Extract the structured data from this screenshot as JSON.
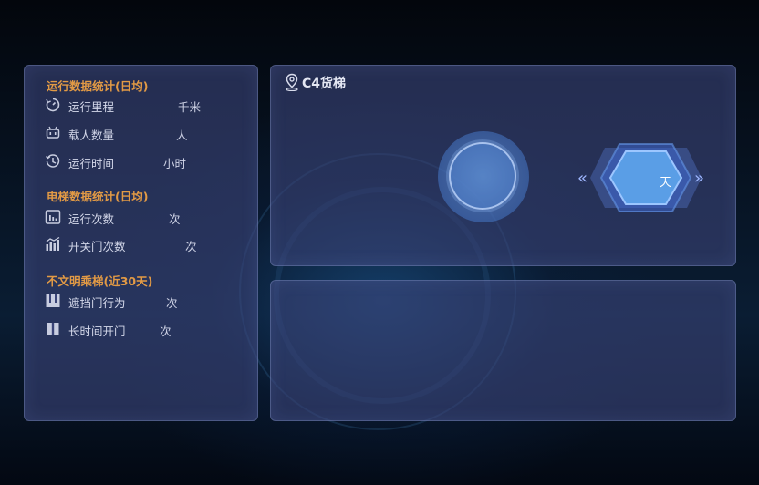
{
  "running_stats": {
    "title": "运行数据统计(日均)",
    "items": [
      {
        "label": "运行里程",
        "unit": "千米",
        "icon": "dial-icon"
      },
      {
        "label": "载人数量",
        "unit": "人",
        "icon": "robot-icon"
      },
      {
        "label": "运行时间",
        "unit": "小时",
        "icon": "history-icon"
      }
    ]
  },
  "elevator_stats": {
    "title": "电梯数据统计(日均)",
    "items": [
      {
        "label": "运行次数",
        "unit": "次",
        "icon": "bar-chart-icon"
      },
      {
        "label": "开关门次数",
        "unit": "次",
        "icon": "column-chart-icon"
      }
    ]
  },
  "uncivilized": {
    "title": "不文明乘梯(近30天)",
    "items": [
      {
        "label": "遮挡门行为",
        "unit": "次",
        "icon": "door-block-icon"
      },
      {
        "label": "长时间开门",
        "unit": "次",
        "icon": "door-open-icon"
      }
    ]
  },
  "device": {
    "name": "C4货梯",
    "icon": "location-pin-icon",
    "days_unit": "天"
  },
  "colors": {
    "section_title": "#e29a45",
    "panel_bg": "#3a4478",
    "accent_blue": "#4a8be0"
  }
}
